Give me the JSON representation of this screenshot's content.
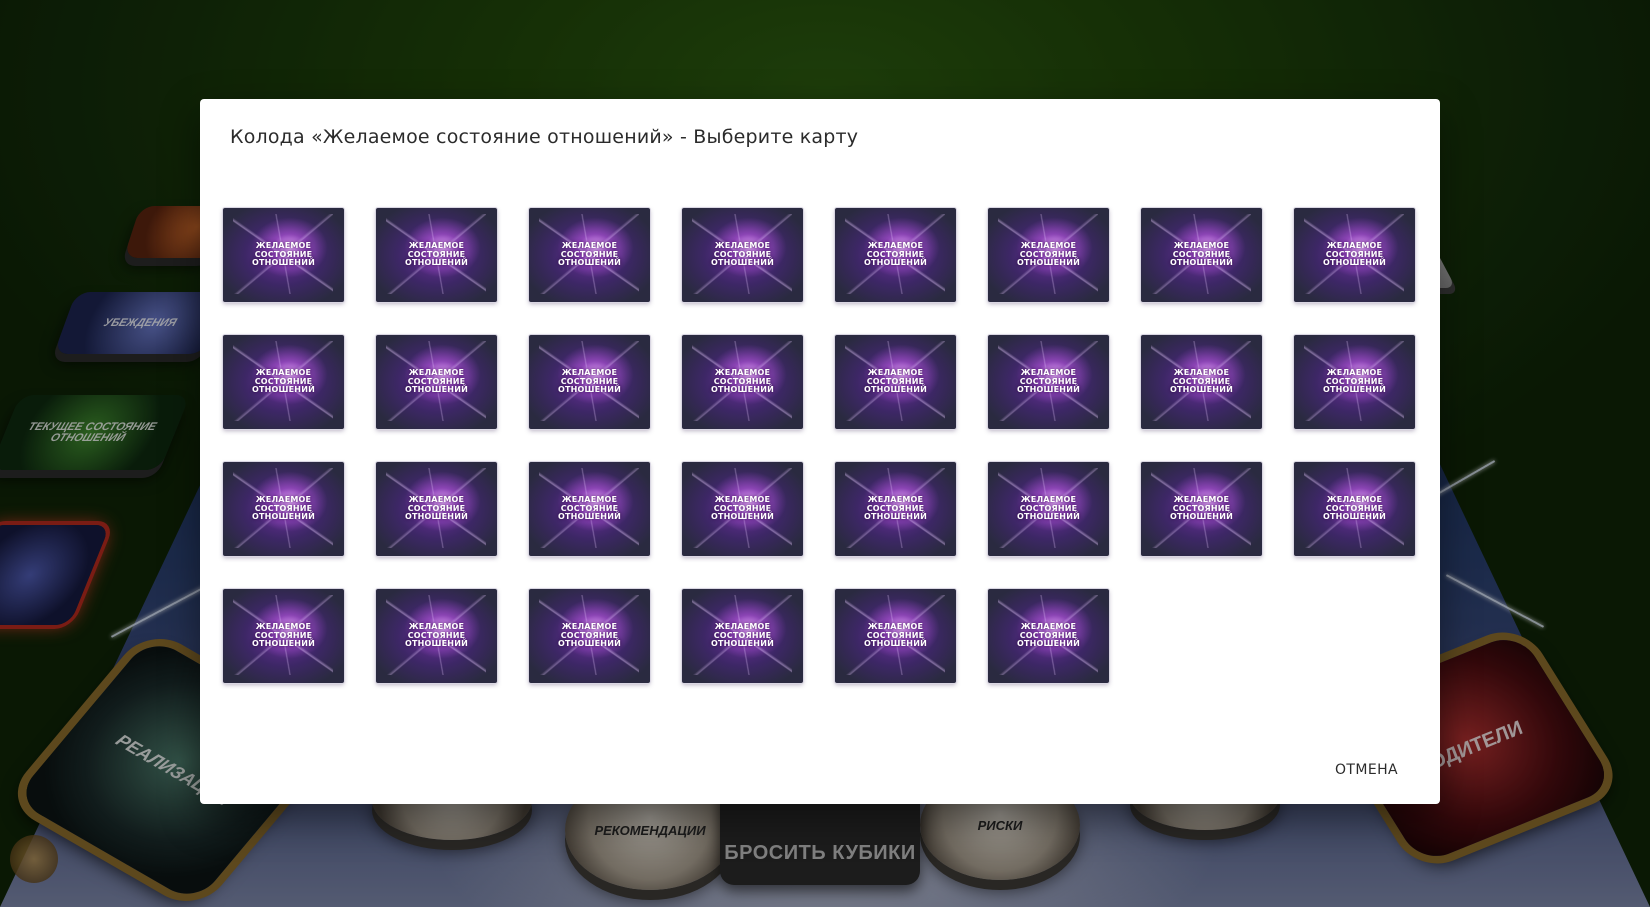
{
  "background": {
    "cards": [
      {
        "name": "beliefs",
        "label": "УБЕЖДЕНИЯ"
      },
      {
        "name": "current-state",
        "label": "ТЕКУЩЕЕ СОСТОЯНИЕ ОТНОШЕНИЙ"
      },
      {
        "name": "realization",
        "label": "РЕАЛИЗАЦИЯ"
      },
      {
        "name": "parents",
        "label": "РОДИТЕЛИ"
      }
    ],
    "coins": [
      {
        "name": "recommendations",
        "label": "РЕКОМЕНДАЦИИ"
      },
      {
        "name": "risks",
        "label": "РИСКИ"
      }
    ],
    "roll_button": {
      "label": "БРОСИТЬ КУБИКИ"
    }
  },
  "modal": {
    "title": "Колода «Желаемое состояние отношений» - Выберите карту",
    "card_label": "ЖЕЛАЕМОЕ СОСТОЯНИЕ ОТНОШЕНИЙ",
    "card_count": 30,
    "cancel_label": "ОТМЕНА"
  },
  "colors": {
    "table_green": "#1f4409",
    "modal_bg": "#ffffff",
    "card_purple": "#6b2f9c"
  }
}
